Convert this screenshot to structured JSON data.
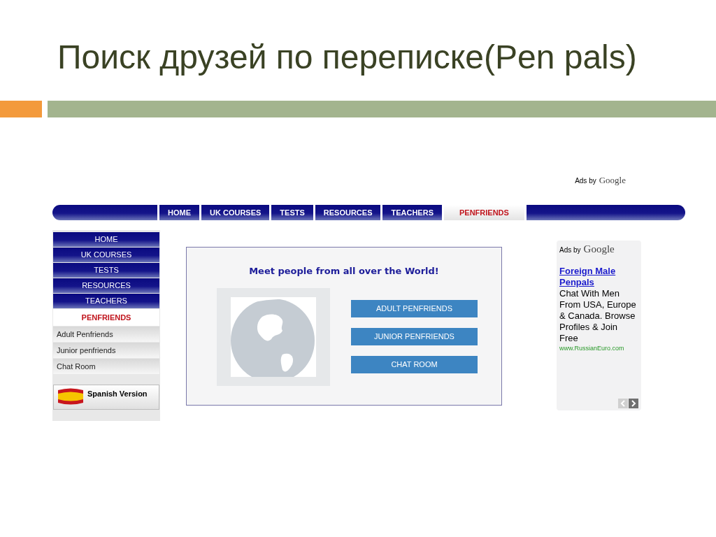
{
  "slide_title": "Поиск друзей по переписке(Pen pals)",
  "site": {
    "ads_label": {
      "prefix": "Ads by",
      "brand": "Google"
    },
    "top_nav": [
      {
        "label": "HOME",
        "selected": false
      },
      {
        "label": "UK COURSES",
        "selected": false
      },
      {
        "label": "TESTS",
        "selected": false
      },
      {
        "label": "RESOURCES",
        "selected": false
      },
      {
        "label": "TEACHERS",
        "selected": false
      },
      {
        "label": "PENFRIENDS",
        "selected": true
      }
    ],
    "side_nav": [
      {
        "label": "HOME",
        "kind": "main",
        "selected": false
      },
      {
        "label": "UK COURSES",
        "kind": "main",
        "selected": false
      },
      {
        "label": "TESTS",
        "kind": "main",
        "selected": false
      },
      {
        "label": "RESOURCES",
        "kind": "main",
        "selected": false
      },
      {
        "label": "TEACHERS",
        "kind": "main",
        "selected": false
      },
      {
        "label": "PENFRIENDS",
        "kind": "main",
        "selected": true
      },
      {
        "label": "Adult Penfriends",
        "kind": "sub",
        "selected": false
      },
      {
        "label": "Junior penfriends",
        "kind": "sub",
        "selected": false
      },
      {
        "label": "Chat Room",
        "kind": "sub",
        "selected": false
      }
    ],
    "language_button": "Spanish Version",
    "main": {
      "heading": "Meet people from all over the World!",
      "buttons": [
        "ADULT PENFRIENDS",
        "JUNIOR PENFRIENDS",
        "CHAT ROOM"
      ]
    },
    "ad": {
      "prefix": "Ads by",
      "brand": "Google",
      "title": "Foreign Male Penpals",
      "body": "Chat With Men From USA, Europe & Canada. Browse Profiles & Join Free",
      "url": "www.RussianEuro.com"
    }
  }
}
